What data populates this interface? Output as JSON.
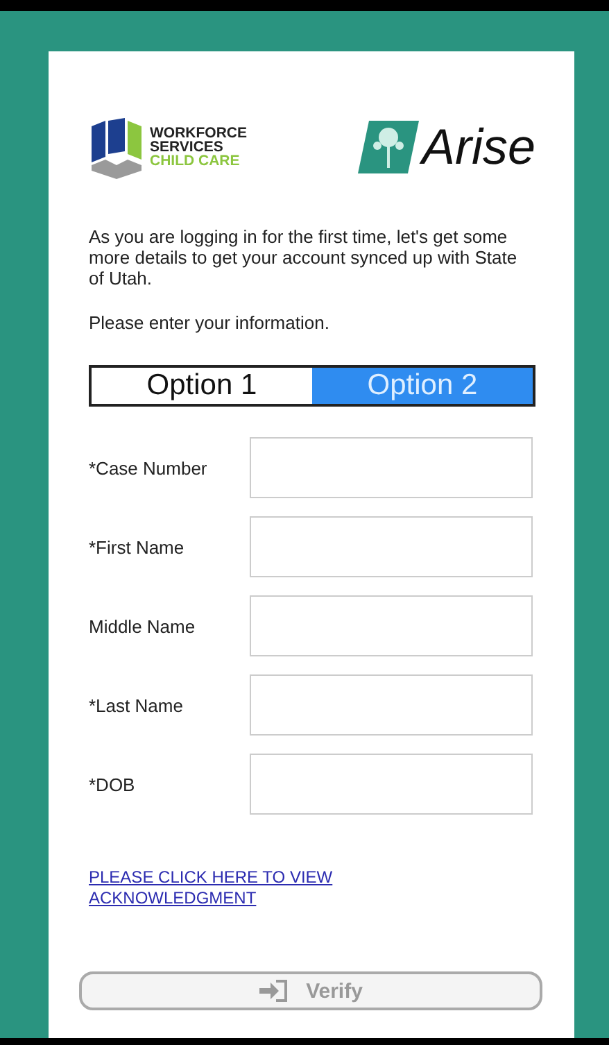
{
  "logos": {
    "workforce": [
      "WORKFORCE",
      "SERVICES",
      "CHILD CARE"
    ],
    "arise": "Arise"
  },
  "intro": "As you are logging in for the first time, let's get some more details to get your account synced up with State of Utah.",
  "prompt": "Please enter your information.",
  "options": [
    {
      "label": "Option 1",
      "selected": false
    },
    {
      "label": "Option 2",
      "selected": true
    }
  ],
  "fields": [
    {
      "label": "*Case Number"
    },
    {
      "label": "*First Name"
    },
    {
      "label": "Middle Name"
    },
    {
      "label": "*Last Name"
    },
    {
      "label": "*DOB"
    }
  ],
  "link": "PLEASE CLICK HERE TO VIEW ACKNOWLEDGMENT",
  "button": {
    "label": "Verify",
    "disabled": true
  }
}
